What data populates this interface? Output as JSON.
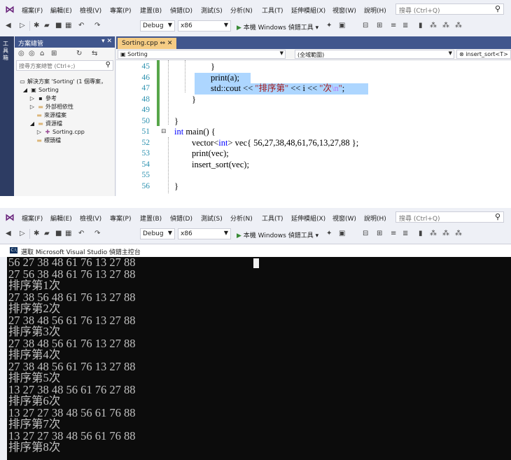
{
  "menu": {
    "items": [
      "檔案(F)",
      "編輯(E)",
      "檢視(V)",
      "專案(P)",
      "建置(B)",
      "偵錯(D)",
      "測試(S)",
      "分析(N)",
      "工具(T)",
      "延伸模組(X)",
      "視窗(W)",
      "說明(H)"
    ],
    "search_placeholder": "搜尋 (Ctrl+Q)"
  },
  "toolbar": {
    "config": "Debug",
    "platform": "x86",
    "run_label": "本機 Windows 偵錯工具"
  },
  "side_tab": "工具箱",
  "solution_explorer": {
    "title": "方案總管",
    "search_placeholder": "搜尋方案總管 (Ctrl+;)",
    "items": [
      {
        "label": "解決方案 'Sorting' (1 個專案，",
        "indent": 0
      },
      {
        "label": "Sorting",
        "indent": 1
      },
      {
        "label": "參考",
        "indent": 2
      },
      {
        "label": "外部相依性",
        "indent": 2
      },
      {
        "label": "來源檔案",
        "indent": 2
      },
      {
        "label": "資源檔",
        "indent": 2
      },
      {
        "label": "Sorting.cpp",
        "indent": 3
      },
      {
        "label": "標頭檔",
        "indent": 2
      }
    ]
  },
  "editor": {
    "tab_label": "Sorting.cpp",
    "nav_project": "Sorting",
    "nav_scope": "(全域範圍)",
    "nav_member": "insert_sort<T>",
    "line_numbers": [
      "45",
      "46",
      "47",
      "48",
      "49",
      "50",
      "51",
      "52",
      "53",
      "54",
      "55",
      "56"
    ],
    "code": {
      "l45": "}",
      "l46": "print(a);",
      "l47_a": "std::cout << ",
      "l47_s1": "\"排序第\"",
      "l47_b": " << i << ",
      "l47_s2a": "\"次",
      "l47_s2b": "\\n",
      "l47_s2c": "\"",
      "l47_c": ";",
      "l48": "}",
      "l50": "}",
      "l51_kw": "int",
      "l51_rest": " main() {",
      "l52_a": "vector<",
      "l52_kw": "int",
      "l52_b": "> vec{ 56,27,38,48,61,76,13,27,88 };",
      "l53": "print(vec);",
      "l54": "insert_sort(vec);",
      "l56": "}"
    }
  },
  "console": {
    "title": "選取 Microsoft Visual Studio 偵錯主控台",
    "lines": [
      "56 27 38 48 61 76 13 27 88",
      "27 56 38 48 61 76 13 27 88",
      "排序第1次",
      "27 38 56 48 61 76 13 27 88",
      "排序第2次",
      "27 38 48 56 61 76 13 27 88",
      "排序第3次",
      "27 38 48 56 61 76 13 27 88",
      "排序第4次",
      "27 38 48 56 61 76 13 27 88",
      "排序第5次",
      "13 27 38 48 56 61 76 27 88",
      "排序第6次",
      "13 27 27 38 48 56 61 76 88",
      "排序第7次",
      "13 27 27 38 48 56 61 76 88",
      "排序第8次"
    ]
  }
}
